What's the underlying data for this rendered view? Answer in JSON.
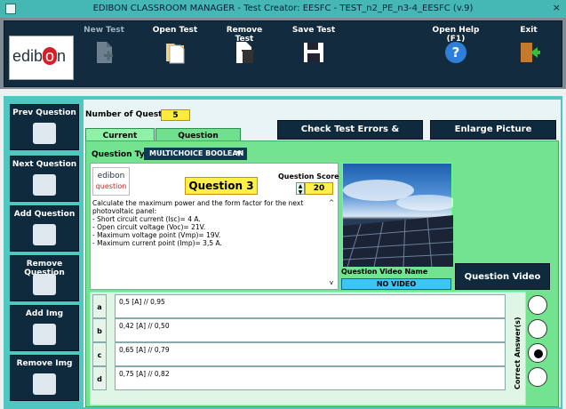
{
  "window": {
    "title": "EDIBON CLASSROOM MANAGER - Test Creator: EESFC - TEST_n2_PE_n3-4_EESFC (v.9)",
    "close": "×"
  },
  "logo": {
    "prefix": "edib",
    "dot": "o",
    "suffix": "n"
  },
  "toolbar": [
    {
      "label": "New Test",
      "icon": "new-document-icon",
      "enabled": false
    },
    {
      "label": "Open Test",
      "icon": "open-document-icon",
      "enabled": true
    },
    {
      "label": "Remove Test",
      "icon": "trash-document-icon",
      "enabled": true
    },
    {
      "label": "Save Test",
      "icon": "floppy-disk-icon",
      "enabled": true
    },
    {
      "label": "Open Help (F1)",
      "icon": "help-question-icon",
      "enabled": true
    },
    {
      "label": "Exit",
      "icon": "exit-door-icon",
      "enabled": true
    }
  ],
  "nav": [
    {
      "label": "Prev Question",
      "icon": "prev-question-icon"
    },
    {
      "label": "Next Question",
      "icon": "next-question-icon"
    },
    {
      "label": "Add Question",
      "icon": "add-question-icon"
    },
    {
      "label": "Remove Question",
      "icon": "remove-question-icon"
    },
    {
      "label": "Add Img",
      "icon": "add-image-icon"
    },
    {
      "label": "Remove Img",
      "icon": "remove-image-icon"
    }
  ],
  "header": {
    "num_questions_label": "Number of Questions",
    "num_questions_value": "5",
    "check_button": "Check Test Errors & Warnings",
    "enlarge_button": "Enlarge Picture"
  },
  "tabs": [
    {
      "label": "Current Question",
      "active": true
    },
    {
      "label": "Question Explanation",
      "active": false
    }
  ],
  "question": {
    "type_label": "Question Type",
    "type_value": "MULTICHOICE BOOLEAN",
    "mini_logo_top": "edibon",
    "mini_logo_bottom": "question",
    "title": "Question 3",
    "score_label": "Question Score",
    "score_value": "20",
    "text": "Calculate the maximum power and the form factor for the next photovoltaic panel:\n- Short circuit current (Isc)= 4 A.\n- Open circuit voltage (Voc)= 21V.\n- Maximum voltage point (Vmp)= 19V.\n- Maximum current point (Imp)= 3,5 A."
  },
  "video": {
    "name_label": "Question Video Name",
    "name_value": "NO VIDEO",
    "button": "Question Video"
  },
  "answers": [
    {
      "letter": "a",
      "text": "0,5 [A]  //  0,95",
      "correct": false
    },
    {
      "letter": "b",
      "text": "0,42 [A]  //  0,50",
      "correct": false
    },
    {
      "letter": "c",
      "text": "0,65 [A]  //  0,79",
      "correct": true
    },
    {
      "letter": "d",
      "text": "0,75 [A]  //  0,82",
      "correct": false
    }
  ],
  "correct_label": "Correct Answer(s)",
  "colors": {
    "teal": "#4fc7c0",
    "green": "#74e38f",
    "navy": "#102a3d",
    "yellow": "#ffef4a"
  }
}
